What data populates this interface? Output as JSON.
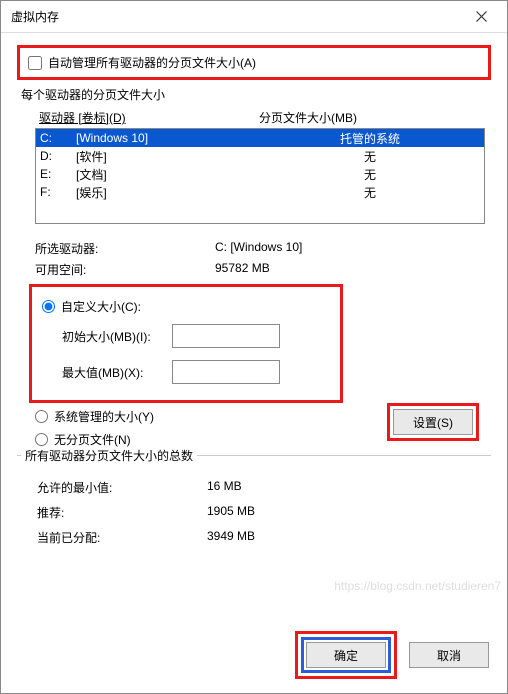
{
  "titlebar": {
    "title": "虚拟内存"
  },
  "auto_manage": {
    "label": "自动管理所有驱动器的分页文件大小(A)",
    "checked": false
  },
  "section_each_drive": "每个驱动器的分页文件大小",
  "drive_header": {
    "col1": "驱动器 [卷标](D)",
    "col2": "分页文件大小(MB)"
  },
  "drives": [
    {
      "letter": "C:",
      "label": "[Windows 10]",
      "size": "托管的系统",
      "selected": true
    },
    {
      "letter": "D:",
      "label": "[软件]",
      "size": "无",
      "selected": false
    },
    {
      "letter": "E:",
      "label": "[文档]",
      "size": "无",
      "selected": false
    },
    {
      "letter": "F:",
      "label": "[娱乐]",
      "size": "无",
      "selected": false
    }
  ],
  "selected_drive": {
    "label": "所选驱动器:",
    "value": "C:  [Windows 10]"
  },
  "available_space": {
    "label": "可用空间:",
    "value": "95782 MB"
  },
  "custom": {
    "radio_label": "自定义大小(C):",
    "initial_label": "初始大小(MB)(I):",
    "initial_value": "",
    "max_label": "最大值(MB)(X):",
    "max_value": ""
  },
  "sys_managed": {
    "label": "系统管理的大小(Y)"
  },
  "no_paging": {
    "label": "无分页文件(N)"
  },
  "set_button": "设置(S)",
  "totals_title": "所有驱动器分页文件大小的总数",
  "totals": {
    "min": {
      "label": "允许的最小值:",
      "value": "16 MB"
    },
    "rec": {
      "label": "推荐:",
      "value": "1905 MB"
    },
    "cur": {
      "label": "当前已分配:",
      "value": "3949 MB"
    }
  },
  "footer": {
    "ok": "确定",
    "cancel": "取消"
  },
  "watermark": "https://blog.csdn.net/studieren7"
}
